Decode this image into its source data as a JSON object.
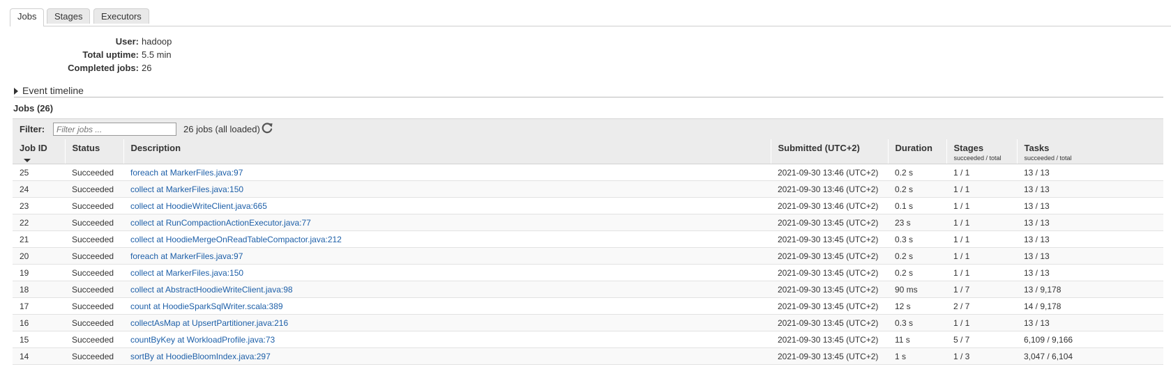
{
  "tabs": [
    {
      "label": "Jobs",
      "active": true
    },
    {
      "label": "Stages",
      "active": false
    },
    {
      "label": "Executors",
      "active": false
    }
  ],
  "summary": {
    "user_label": "User:",
    "user_value": "hadoop",
    "uptime_label": "Total uptime:",
    "uptime_value": "5.5 min",
    "completed_label": "Completed jobs:",
    "completed_value": "26"
  },
  "timeline": {
    "label": "Event timeline"
  },
  "jobs_heading": "Jobs (26)",
  "filter": {
    "label": "Filter:",
    "placeholder": "Filter jobs ...",
    "count_text": "26 jobs (all loaded)",
    "icon": "refresh-icon"
  },
  "table": {
    "headers": {
      "job_id": "Job ID",
      "status": "Status",
      "description": "Description",
      "submitted": "Submitted (UTC+2)",
      "duration": "Duration",
      "stages": "Stages",
      "stages_sub": "succeeded / total",
      "tasks": "Tasks",
      "tasks_sub": "succeeded / total"
    },
    "rows": [
      {
        "id": "25",
        "status": "Succeeded",
        "desc": "foreach at MarkerFiles.java:97",
        "submitted": "2021-09-30 13:46 (UTC+2)",
        "duration": "0.2 s",
        "stages": "1 / 1",
        "tasks": "13 / 13"
      },
      {
        "id": "24",
        "status": "Succeeded",
        "desc": "collect at MarkerFiles.java:150",
        "submitted": "2021-09-30 13:46 (UTC+2)",
        "duration": "0.2 s",
        "stages": "1 / 1",
        "tasks": "13 / 13"
      },
      {
        "id": "23",
        "status": "Succeeded",
        "desc": "collect at HoodieWriteClient.java:665",
        "submitted": "2021-09-30 13:46 (UTC+2)",
        "duration": "0.1 s",
        "stages": "1 / 1",
        "tasks": "13 / 13"
      },
      {
        "id": "22",
        "status": "Succeeded",
        "desc": "collect at RunCompactionActionExecutor.java:77",
        "submitted": "2021-09-30 13:45 (UTC+2)",
        "duration": "23 s",
        "stages": "1 / 1",
        "tasks": "13 / 13"
      },
      {
        "id": "21",
        "status": "Succeeded",
        "desc": "collect at HoodieMergeOnReadTableCompactor.java:212",
        "submitted": "2021-09-30 13:45 (UTC+2)",
        "duration": "0.3 s",
        "stages": "1 / 1",
        "tasks": "13 / 13"
      },
      {
        "id": "20",
        "status": "Succeeded",
        "desc": "foreach at MarkerFiles.java:97",
        "submitted": "2021-09-30 13:45 (UTC+2)",
        "duration": "0.2 s",
        "stages": "1 / 1",
        "tasks": "13 / 13"
      },
      {
        "id": "19",
        "status": "Succeeded",
        "desc": "collect at MarkerFiles.java:150",
        "submitted": "2021-09-30 13:45 (UTC+2)",
        "duration": "0.2 s",
        "stages": "1 / 1",
        "tasks": "13 / 13"
      },
      {
        "id": "18",
        "status": "Succeeded",
        "desc": "collect at AbstractHoodieWriteClient.java:98",
        "submitted": "2021-09-30 13:45 (UTC+2)",
        "duration": "90 ms",
        "stages": "1 / 7",
        "tasks": "13 / 9,178"
      },
      {
        "id": "17",
        "status": "Succeeded",
        "desc": "count at HoodieSparkSqlWriter.scala:389",
        "submitted": "2021-09-30 13:45 (UTC+2)",
        "duration": "12 s",
        "stages": "2 / 7",
        "tasks": "14 / 9,178"
      },
      {
        "id": "16",
        "status": "Succeeded",
        "desc": "collectAsMap at UpsertPartitioner.java:216",
        "submitted": "2021-09-30 13:45 (UTC+2)",
        "duration": "0.3 s",
        "stages": "1 / 1",
        "tasks": "13 / 13"
      },
      {
        "id": "15",
        "status": "Succeeded",
        "desc": "countByKey at WorkloadProfile.java:73",
        "submitted": "2021-09-30 13:45 (UTC+2)",
        "duration": "11 s",
        "stages": "5 / 7",
        "tasks": "6,109 / 9,166"
      },
      {
        "id": "14",
        "status": "Succeeded",
        "desc": "sortBy at HoodieBloomIndex.java:297",
        "submitted": "2021-09-30 13:45 (UTC+2)",
        "duration": "1 s",
        "stages": "1 / 3",
        "tasks": "3,047 / 6,104"
      }
    ]
  },
  "colors": {
    "link": "#1d5fa8",
    "header_bg": "#ececec",
    "row_alt_bg": "#f9f9f9"
  }
}
